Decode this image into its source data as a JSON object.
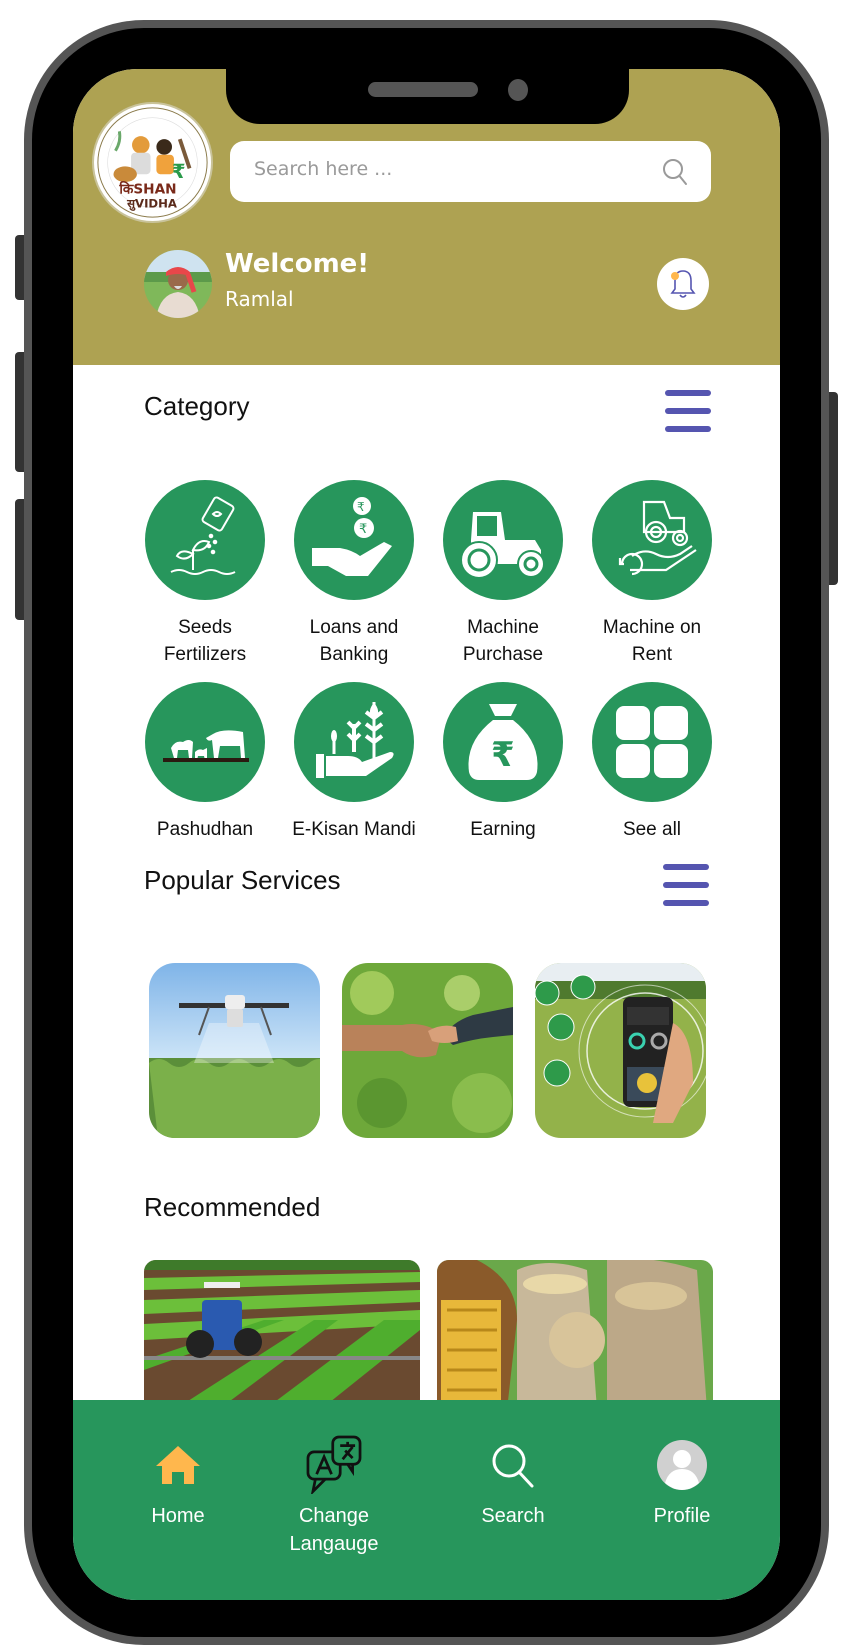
{
  "app": {
    "name": "Kishan Suvidha",
    "logo_text_line1": "किSHAN",
    "logo_text_line2": "सुVIDHA"
  },
  "colors": {
    "header_bg": "#aea252",
    "accent_green": "#27965c",
    "menu_icon": "#5555b0",
    "home_active": "#ffb74d"
  },
  "header": {
    "search_placeholder": "Search here ...",
    "welcome": "Welcome!",
    "user_name": "Ramlal",
    "notification_icon": "bell-icon"
  },
  "category": {
    "title": "Category",
    "items": [
      {
        "line1": "Seeds",
        "line2": "Fertilizers",
        "icon": "seed-sowing-icon"
      },
      {
        "line1": "Loans and",
        "line2": "Banking",
        "icon": "hand-coins-icon"
      },
      {
        "line1": "Machine",
        "line2": "Purchase",
        "icon": "tractor-icon"
      },
      {
        "line1": "Machine on",
        "line2": "Rent",
        "icon": "tractor-rent-icon"
      },
      {
        "line1": "Pashudhan",
        "line2": "",
        "icon": "livestock-icon"
      },
      {
        "line1": "E-Kisan Mandi",
        "line2": "",
        "icon": "plant-hand-icon"
      },
      {
        "line1": "Earning",
        "line2": "",
        "icon": "money-bag-icon"
      },
      {
        "line1": "See all",
        "line2": "",
        "icon": "grid-icon"
      }
    ]
  },
  "popular_services": {
    "title": "Popular Services",
    "items": [
      {
        "image": "crop-spraying-drone"
      },
      {
        "image": "handshake"
      },
      {
        "image": "smart-farming-phone"
      }
    ]
  },
  "recommended": {
    "title": "Recommended",
    "items": [
      {
        "image": "tractor-in-field"
      },
      {
        "image": "grain-sacks-corn"
      }
    ]
  },
  "bottom_nav": {
    "items": [
      {
        "label_line1": "Home",
        "label_line2": "",
        "icon": "home-icon",
        "active": true
      },
      {
        "label_line1": "Change",
        "label_line2": "Langauge",
        "icon": "translate-icon",
        "active": false
      },
      {
        "label_line1": "Search",
        "label_line2": "",
        "icon": "search-icon",
        "active": false
      },
      {
        "label_line1": "Profile",
        "label_line2": "",
        "icon": "profile-icon",
        "active": false
      }
    ]
  }
}
